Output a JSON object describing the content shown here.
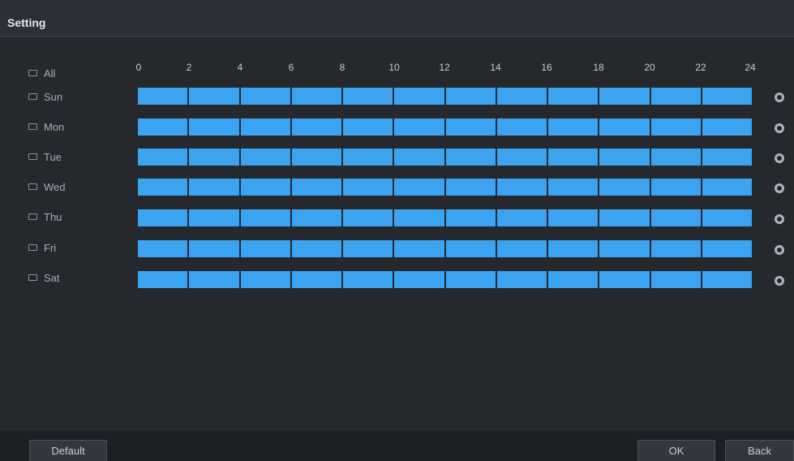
{
  "window": {
    "title": "Setting"
  },
  "schedule": {
    "all_label": "All",
    "hours": [
      "0",
      "2",
      "4",
      "6",
      "8",
      "10",
      "12",
      "14",
      "16",
      "18",
      "20",
      "22",
      "24"
    ],
    "days": [
      {
        "label": "Sun",
        "coverage": 1.0
      },
      {
        "label": "Mon",
        "coverage": 1.0
      },
      {
        "label": "Tue",
        "coverage": 1.0
      },
      {
        "label": "Wed",
        "coverage": 1.0
      },
      {
        "label": "Thu",
        "coverage": 1.0
      },
      {
        "label": "Fri",
        "coverage": 1.0
      },
      {
        "label": "Sat",
        "coverage": 1.0
      }
    ],
    "bar_color": "#3ba3f0",
    "settings_icon": "gear-icon"
  },
  "footer": {
    "default_label": "Default",
    "ok_label": "OK",
    "back_label": "Back"
  }
}
